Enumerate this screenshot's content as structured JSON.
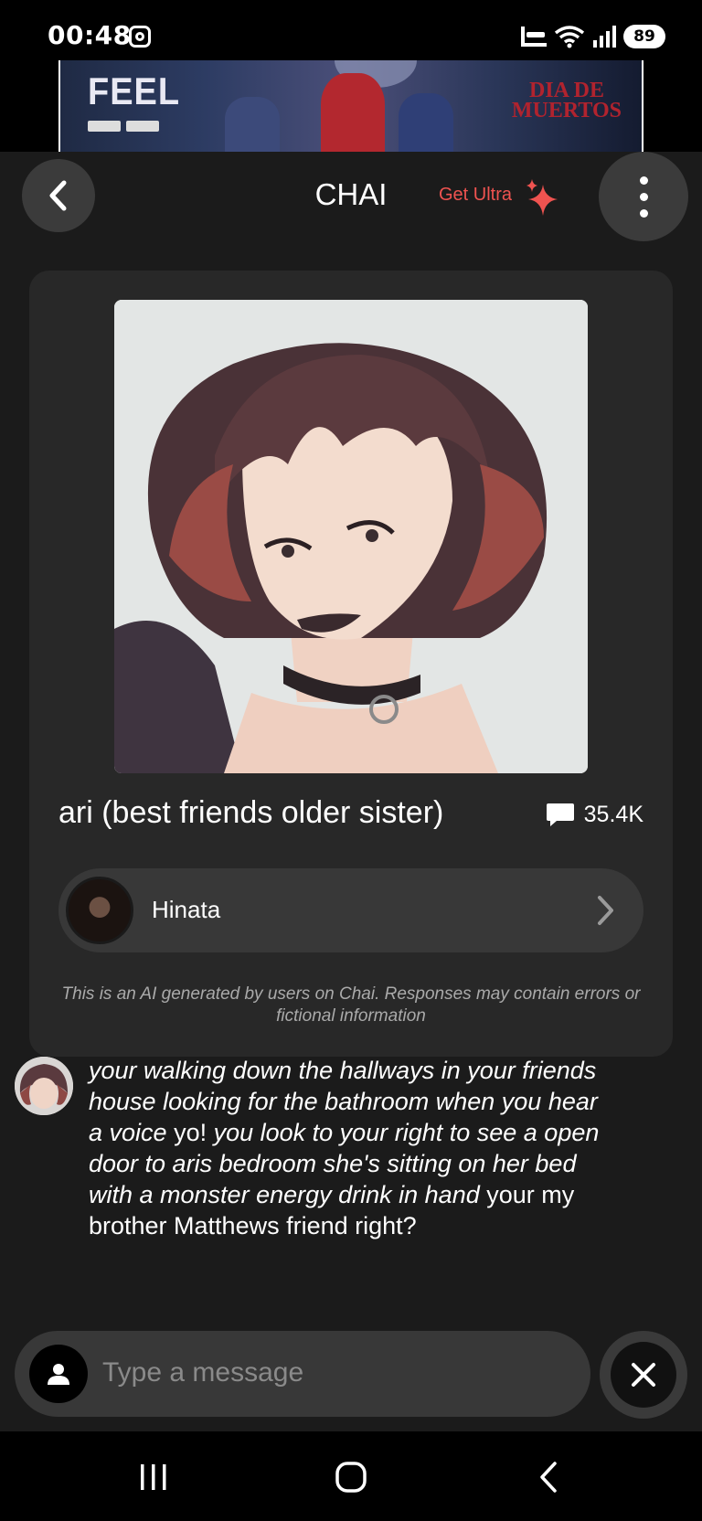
{
  "status_bar": {
    "time": "00:48",
    "battery": "89",
    "icons": [
      "instagram-icon",
      "sleep-mode-icon",
      "wifi-icon",
      "signal-icon"
    ]
  },
  "ad": {
    "brand": "FEEL",
    "title_line1": "DIA DE",
    "title_line2": "MUERTOS"
  },
  "header": {
    "title": "CHAI",
    "ultra_label": "Get Ultra",
    "accent_color": "#ef5350"
  },
  "bot": {
    "name": "ari (best friends older sister)",
    "chat_count": "35.4K"
  },
  "creator": {
    "name": "Hinata"
  },
  "disclaimer": "This is an AI generated by users on Chai. Responses may contain errors or fictional information",
  "message": {
    "part1_italic": "your walking down the hallways in your friends house looking for the bathroom when you hear a voice",
    "part2": " yo! ",
    "part3_italic": "you look to your right to see a open door to aris bedroom she's sitting on her bed with a monster energy drink in hand",
    "part4": " your my brother Matthews friend right?"
  },
  "composer": {
    "placeholder": "Type a message"
  }
}
